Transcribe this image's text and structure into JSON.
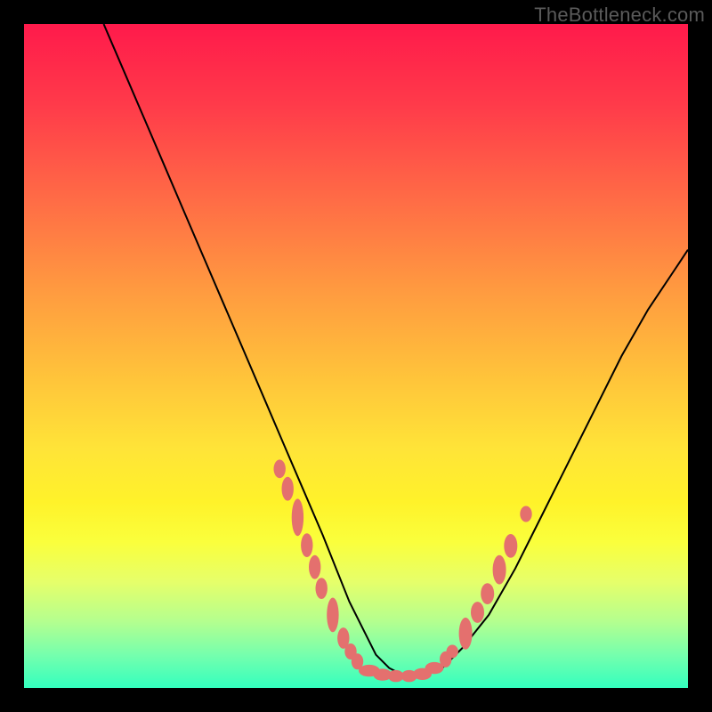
{
  "watermark": "TheBottleneck.com",
  "chart_data": {
    "type": "line",
    "title": "",
    "xlabel": "",
    "ylabel": "",
    "xlim": [
      0,
      100
    ],
    "ylim": [
      0,
      100
    ],
    "series": [
      {
        "name": "curve",
        "x": [
          12,
          15,
          18,
          21,
          24,
          27,
          30,
          33,
          36,
          39,
          42,
          45,
          47,
          49,
          51,
          53,
          55,
          57,
          60,
          63,
          66,
          70,
          74,
          78,
          82,
          86,
          90,
          94,
          98,
          100
        ],
        "y": [
          100,
          93,
          86,
          79,
          72,
          65,
          58,
          51,
          44,
          37,
          30,
          23,
          18,
          13,
          9,
          5,
          3,
          2,
          2,
          3,
          6,
          11,
          18,
          26,
          34,
          42,
          50,
          57,
          63,
          66
        ]
      }
    ],
    "markers": [
      {
        "x": 38.5,
        "y": 33.0,
        "rx": 0.9,
        "ry": 1.4
      },
      {
        "x": 39.7,
        "y": 30.0,
        "rx": 0.9,
        "ry": 1.8
      },
      {
        "x": 41.2,
        "y": 25.7,
        "rx": 0.9,
        "ry": 2.8
      },
      {
        "x": 42.6,
        "y": 21.5,
        "rx": 0.9,
        "ry": 1.8
      },
      {
        "x": 43.8,
        "y": 18.2,
        "rx": 0.9,
        "ry": 1.8
      },
      {
        "x": 44.8,
        "y": 15.0,
        "rx": 0.9,
        "ry": 1.6
      },
      {
        "x": 46.5,
        "y": 11.0,
        "rx": 0.9,
        "ry": 2.6
      },
      {
        "x": 48.1,
        "y": 7.5,
        "rx": 0.9,
        "ry": 1.6
      },
      {
        "x": 49.2,
        "y": 5.5,
        "rx": 0.9,
        "ry": 1.2
      },
      {
        "x": 50.2,
        "y": 4.0,
        "rx": 0.9,
        "ry": 1.2
      },
      {
        "x": 52.0,
        "y": 2.6,
        "rx": 1.6,
        "ry": 0.9
      },
      {
        "x": 54.0,
        "y": 2.0,
        "rx": 1.4,
        "ry": 0.9
      },
      {
        "x": 56.0,
        "y": 1.8,
        "rx": 1.2,
        "ry": 0.9
      },
      {
        "x": 58.0,
        "y": 1.8,
        "rx": 1.2,
        "ry": 0.9
      },
      {
        "x": 60.0,
        "y": 2.1,
        "rx": 1.4,
        "ry": 0.9
      },
      {
        "x": 61.8,
        "y": 3.0,
        "rx": 1.4,
        "ry": 0.9
      },
      {
        "x": 63.5,
        "y": 4.3,
        "rx": 0.9,
        "ry": 1.2
      },
      {
        "x": 64.5,
        "y": 5.5,
        "rx": 0.9,
        "ry": 1.0
      },
      {
        "x": 66.5,
        "y": 8.2,
        "rx": 1.0,
        "ry": 2.4
      },
      {
        "x": 68.3,
        "y": 11.4,
        "rx": 1.0,
        "ry": 1.6
      },
      {
        "x": 69.8,
        "y": 14.2,
        "rx": 1.0,
        "ry": 1.6
      },
      {
        "x": 71.6,
        "y": 17.8,
        "rx": 1.0,
        "ry": 2.2
      },
      {
        "x": 73.3,
        "y": 21.4,
        "rx": 1.0,
        "ry": 1.8
      },
      {
        "x": 75.6,
        "y": 26.2,
        "rx": 0.9,
        "ry": 1.2
      }
    ],
    "marker_color": "#e4706e",
    "curve_color": "#000000"
  }
}
